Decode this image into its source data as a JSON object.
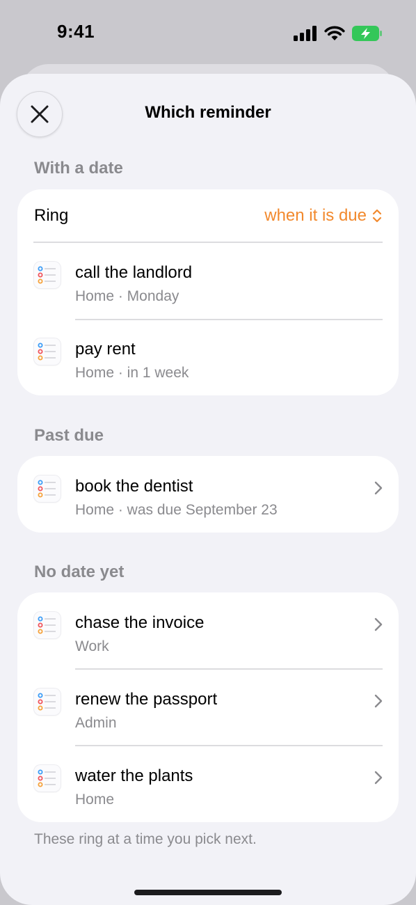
{
  "status_bar": {
    "time": "9:41",
    "icons": [
      "cellular-signal-icon",
      "wifi-icon",
      "battery-charging-icon"
    ],
    "battery_color": "#34c759"
  },
  "sheet": {
    "title": "Which reminder",
    "close_icon": "close-icon"
  },
  "with_date": {
    "header": "With a date",
    "ring_label": "Ring",
    "ring_value": "when it is due",
    "items": [
      {
        "title": "call the landlord",
        "subtitle": "Home · Monday"
      },
      {
        "title": "pay rent",
        "subtitle": "Home · in 1 week"
      }
    ]
  },
  "past_due": {
    "header": "Past due",
    "items": [
      {
        "title": "book the dentist",
        "subtitle": "Home · was due September 23"
      }
    ]
  },
  "no_date": {
    "header": "No date yet",
    "items": [
      {
        "title": "chase the invoice",
        "subtitle": "Work"
      },
      {
        "title": "renew the passport",
        "subtitle": "Admin"
      },
      {
        "title": "water the plants",
        "subtitle": "Home"
      }
    ]
  },
  "footer_note": "These ring at a time you pick next.",
  "colors": {
    "accent": "#f2892d",
    "secondary_text": "#8a8a8e",
    "sheet_background": "#f2f2f7",
    "list_dot_blue": "#3b9cf6",
    "list_dot_red": "#f0545c",
    "list_dot_orange": "#f6a23a"
  }
}
